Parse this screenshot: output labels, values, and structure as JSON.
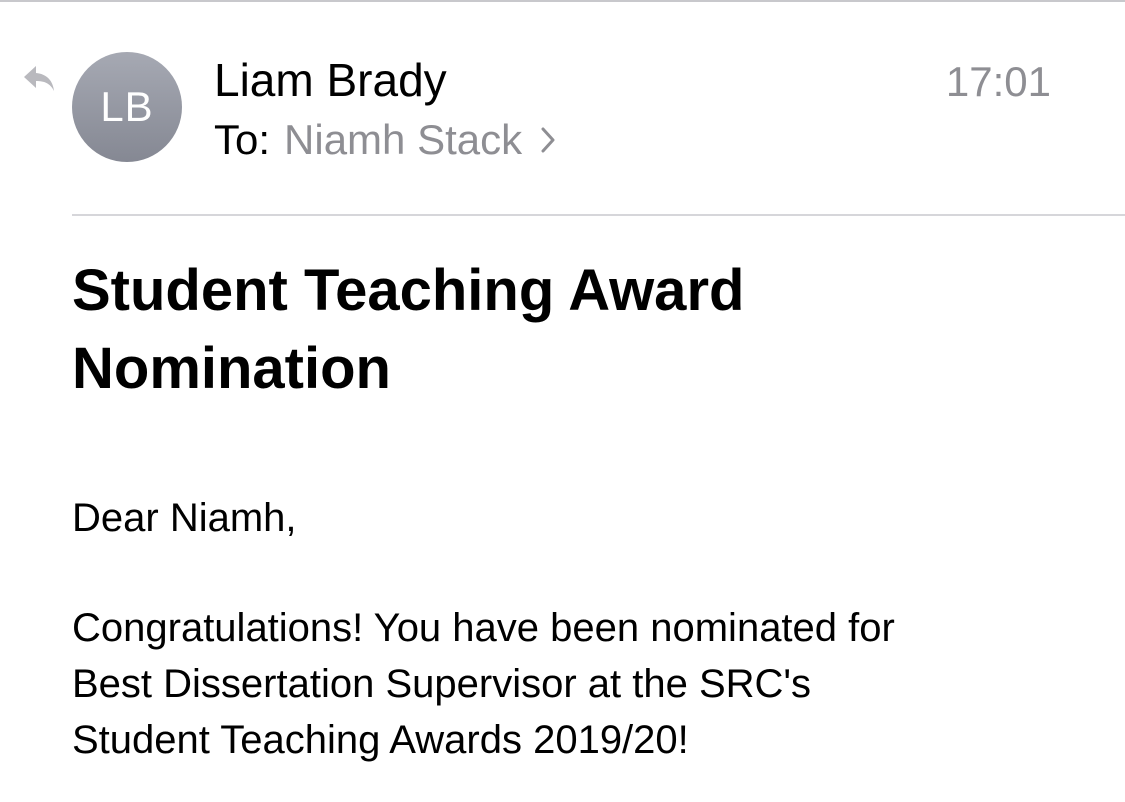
{
  "email": {
    "sender": {
      "initials": "LB",
      "name": "Liam Brady"
    },
    "time": "17:01",
    "to_label": "To:",
    "recipient": "Niamh Stack",
    "subject_lines": [
      "Student Teaching Award",
      "Nomination"
    ],
    "greeting": "Dear Niamh,",
    "body_lines": [
      "Congratulations! You have been nominated for",
      "Best Dissertation Supervisor at the SRC's",
      "Student Teaching Awards 2019/20!"
    ]
  },
  "icons": {
    "reply": "reply-arrow-icon",
    "chevron": "chevron-right-icon"
  },
  "colors": {
    "secondary_text": "#8e8e93",
    "avatar": "#9a9da7",
    "separator": "#d6d6da"
  }
}
